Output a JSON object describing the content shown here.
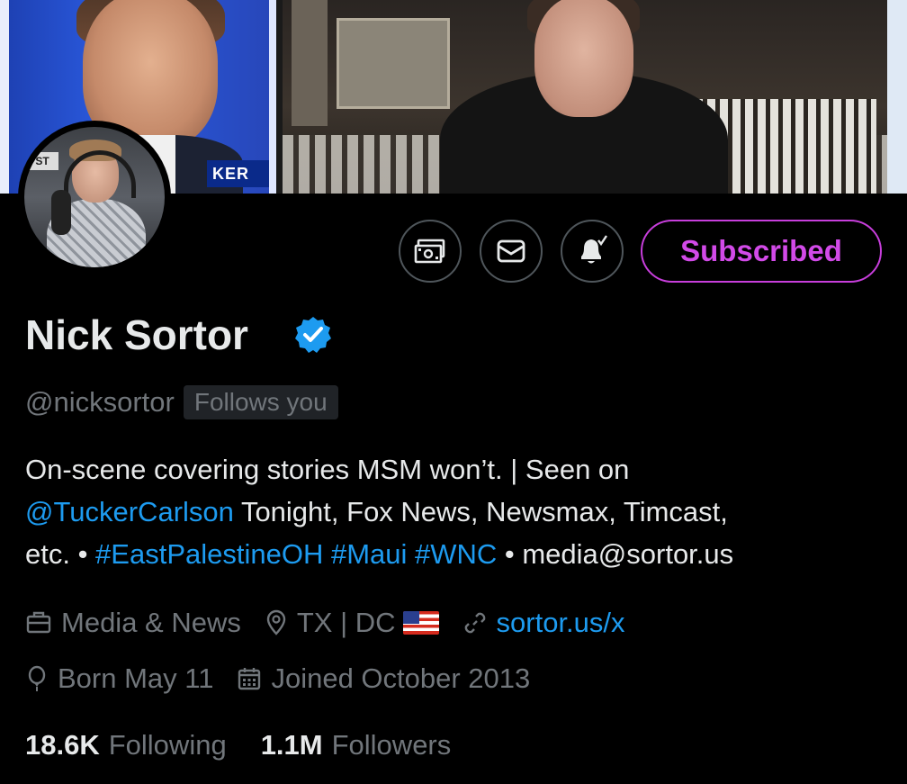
{
  "profile": {
    "name": "Nick Sortor",
    "handle": "@nicksortor",
    "follows_you": "Follows you",
    "bio": {
      "line1": "On-scene covering stories MSM won’t. | Seen on",
      "mention": "@TuckerCarlson",
      "line2_rest": " Tonight, Fox News, Newsmax, Timcast,",
      "line3_start": "etc. • ",
      "hashtags": "#EastPalestineOH #Maui #WNC",
      "line3_end": " • media@sortor.us"
    },
    "category": "Media & News",
    "location": "TX | DC",
    "website": "sortor.us/x",
    "birthday": "Born May 11",
    "joined": "Joined October 2013",
    "following_count": "18.6K",
    "following_label": "Following",
    "followers_count": "1.1M",
    "followers_label": "Followers"
  },
  "banner": {
    "left_panel_text": "KER",
    "avatar_sign_text": "ST"
  },
  "actions": {
    "subscribe_label": "Subscribed",
    "icons": [
      "money-icon",
      "mail-icon",
      "bell-subscribed-icon"
    ]
  },
  "meta_icons": {
    "category": "briefcase-icon",
    "location": "location-pin-icon",
    "website": "link-icon",
    "birthday": "balloon-icon",
    "joined": "calendar-icon",
    "flag": "us-flag-icon"
  },
  "colors": {
    "background": "#000000",
    "text_primary": "#e7e9ea",
    "text_secondary": "#71767b",
    "link": "#1d9bf0",
    "subscribe_accent": "#c73edb",
    "verified": "#1d9bf0"
  }
}
